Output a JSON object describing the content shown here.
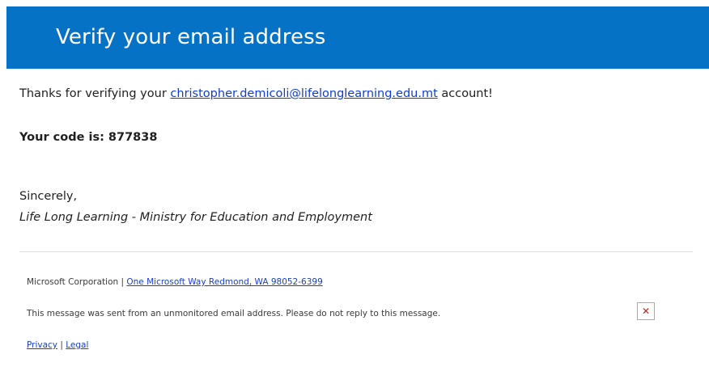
{
  "header": {
    "title": "Verify your email address"
  },
  "body": {
    "intro_prefix": "Thanks for verifying your ",
    "email": "christopher.demicoli@lifelonglearning.edu.mt",
    "intro_suffix": " account!",
    "code_label": "Your code is: 877838",
    "sincerely": "Sincerely,",
    "signature": "Life Long Learning - Ministry for Education and Employment"
  },
  "footer": {
    "company": "Microsoft Corporation",
    "separator": " | ",
    "address": "One Microsoft Way Redmond, WA 98052-6399",
    "notice": "This message was sent from an unmonitored email address. Please do not reply to this message.",
    "privacy": "Privacy",
    "legal": "Legal",
    "image_icon": "broken-image-icon",
    "colors": {
      "banner": "#0672c6",
      "link": "#0b3dd6"
    }
  }
}
